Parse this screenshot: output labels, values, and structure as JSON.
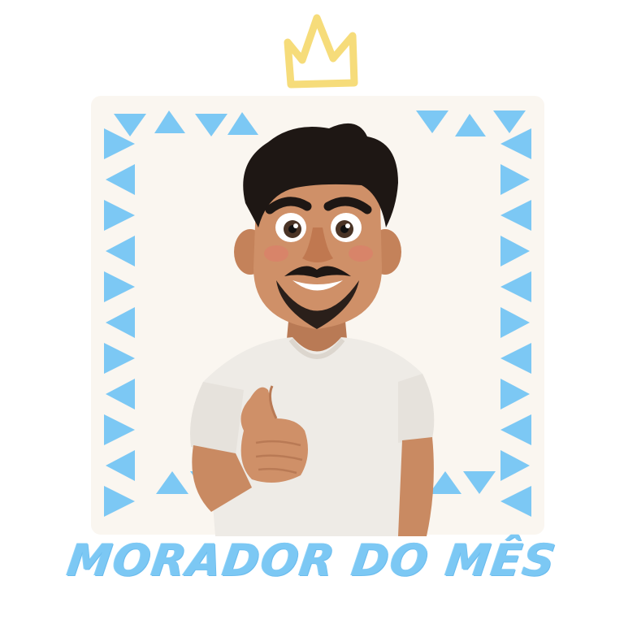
{
  "title": "MORADOR DO MÊS",
  "icons": {
    "crown": "crown-icon",
    "thumbs_up": "thumbs-up-icon"
  },
  "colors": {
    "accent_blue": "#7cc8f4",
    "crown_yellow": "#f6dc7a",
    "frame_cream": "#faf6f0",
    "shirt": "#eeebe6",
    "skin": "#c98a62",
    "hair": "#1e1714"
  }
}
